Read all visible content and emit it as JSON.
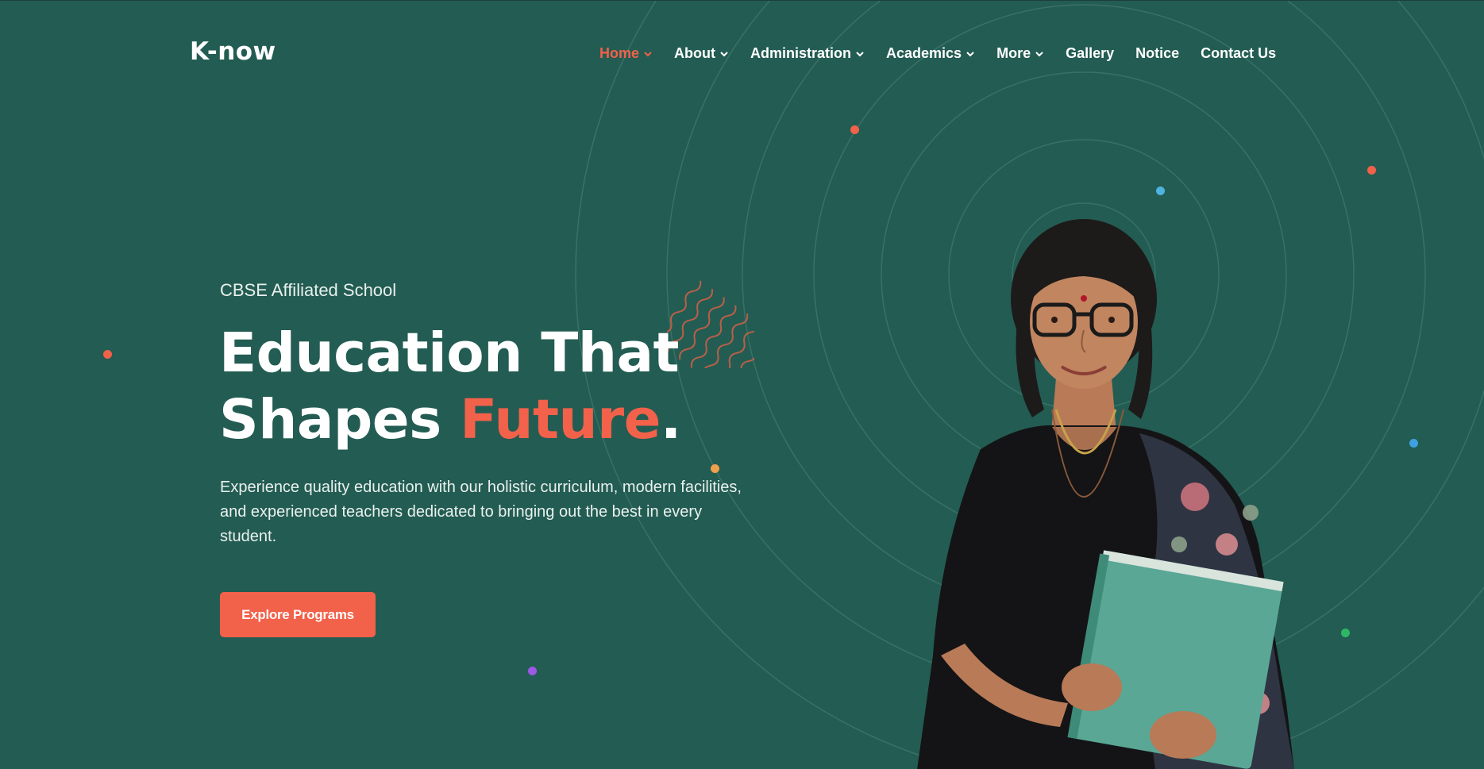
{
  "brand": {
    "logo_text": "K-now"
  },
  "nav": {
    "items": [
      {
        "label": "Home",
        "has_dropdown": true,
        "active": true
      },
      {
        "label": "About",
        "has_dropdown": true,
        "active": false
      },
      {
        "label": "Administration",
        "has_dropdown": true,
        "active": false
      },
      {
        "label": "Academics",
        "has_dropdown": true,
        "active": false
      },
      {
        "label": "More",
        "has_dropdown": true,
        "active": false
      },
      {
        "label": "Gallery",
        "has_dropdown": false,
        "active": false
      },
      {
        "label": "Notice",
        "has_dropdown": false,
        "active": false
      },
      {
        "label": "Contact Us",
        "has_dropdown": false,
        "active": false
      }
    ]
  },
  "hero": {
    "eyebrow": "CBSE Affiliated School",
    "headline_line1": "Education That",
    "headline_line2_prefix": "Shapes ",
    "headline_accent": "Future",
    "headline_suffix": ".",
    "description": "Experience quality education with our holistic curriculum, modern facilities, and experienced teachers dedicated to bringing out the best in every student.",
    "cta_label": "Explore Programs",
    "image_icon": "teacher-portrait-image"
  },
  "colors": {
    "background": "#235c52",
    "accent": "#f2614a",
    "text": "#ffffff",
    "ring": "#3d7469"
  }
}
